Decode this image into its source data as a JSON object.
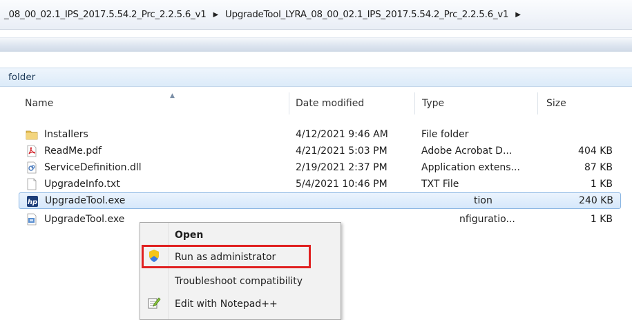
{
  "breadcrumb": {
    "items": [
      "_08_00_02.1_IPS_2017.5.54.2_Prc_2.2.5.6_v1",
      "UpgradeTool_LYRA_08_00_02.1_IPS_2017.5.54.2_Prc_2.2.5.6_v1"
    ],
    "separator": "▶"
  },
  "folder_band": {
    "label": "folder"
  },
  "columns": {
    "name": "Name",
    "date": "Date modified",
    "type": "Type",
    "size": "Size"
  },
  "files": [
    {
      "name": "Installers",
      "date": "4/12/2021 9:46 AM",
      "type": "File folder",
      "size": "",
      "icon": "folder-icon"
    },
    {
      "name": "ReadMe.pdf",
      "date": "4/21/2021 5:03 PM",
      "type": "Adobe Acrobat D...",
      "size": "404 KB",
      "icon": "pdf-file-icon"
    },
    {
      "name": "ServiceDefinition.dll",
      "date": "2/19/2021 2:37 PM",
      "type": "Application extens...",
      "size": "87 KB",
      "icon": "dll-file-icon"
    },
    {
      "name": "UpgradeInfo.txt",
      "date": "5/4/2021 10:46 PM",
      "type": "TXT File",
      "size": "1 KB",
      "icon": "text-file-icon"
    },
    {
      "name": "UpgradeTool.exe",
      "date": "",
      "type": "tion",
      "size": "240 KB",
      "icon": "hp-exe-icon",
      "selected": true
    },
    {
      "name": "UpgradeTool.exe",
      "date": "",
      "type": "nfiguratio...",
      "size": "1 KB",
      "icon": "config-file-icon"
    }
  ],
  "context_menu": {
    "items": [
      {
        "label": "Open",
        "bold": true,
        "icon": ""
      },
      {
        "label": "Run as administrator",
        "icon": "uac-shield-icon",
        "highlighted": true
      },
      {
        "label": "Troubleshoot compatibility",
        "icon": ""
      },
      {
        "label": "Edit with Notepad++",
        "icon": "notepad-plus-plus-icon"
      }
    ]
  },
  "colors": {
    "highlight_box": "#e02020",
    "selection_border": "#8bb6e3",
    "folder_band": "#dcebf9"
  }
}
